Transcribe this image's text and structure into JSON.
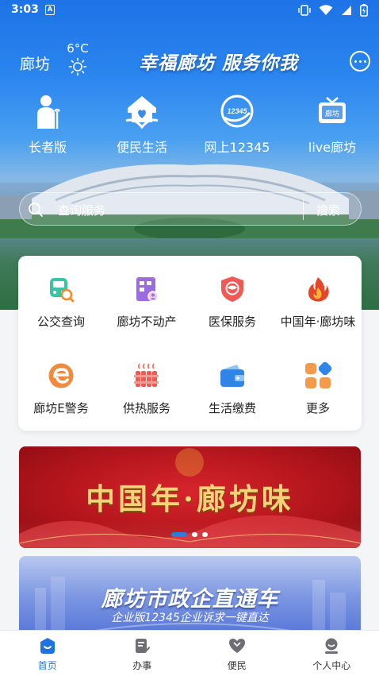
{
  "status_bar": {
    "time": "3:03",
    "notif_letter": "A"
  },
  "header": {
    "city": "廊坊",
    "temperature": "6°C",
    "weather_icon": "sun-icon",
    "slogan": "幸福廊坊 服务你我"
  },
  "quick_entries": [
    {
      "label": "长者版",
      "icon": "elder-icon"
    },
    {
      "label": "便民生活",
      "icon": "home-heart-icon"
    },
    {
      "label": "网上12345",
      "icon": "hotline-12345-icon",
      "badge": "12345"
    },
    {
      "label": "live廊坊",
      "icon": "tv-icon",
      "badge": "廊坊"
    }
  ],
  "search": {
    "placeholder": "查询服务",
    "button": "搜索"
  },
  "services": [
    {
      "label": "公交查询",
      "icon": "bus-search-icon"
    },
    {
      "label": "廊坊不动产",
      "icon": "property-icon"
    },
    {
      "label": "医保服务",
      "icon": "medical-insurance-icon"
    },
    {
      "label": "中国年·廊坊味",
      "icon": "flame-icon"
    },
    {
      "label": "廊坊E警务",
      "icon": "police-e-icon"
    },
    {
      "label": "供热服务",
      "icon": "heater-icon"
    },
    {
      "label": "生活缴费",
      "icon": "wallet-icon"
    },
    {
      "label": "更多",
      "icon": "more-grid-icon"
    }
  ],
  "banners": [
    {
      "title": "中国年·廊坊味"
    },
    {
      "title": "廊坊市政企直通车",
      "subtitle": "企业版12345企业诉求一键直达"
    }
  ],
  "carousel": {
    "count": 3,
    "active_index": 0
  },
  "tabbar": [
    {
      "label": "首页",
      "icon": "home-icon",
      "active": true
    },
    {
      "label": "办事",
      "icon": "task-icon",
      "active": false
    },
    {
      "label": "便民",
      "icon": "heart-icon",
      "active": false
    },
    {
      "label": "个人中心",
      "icon": "user-icon",
      "active": false
    }
  ],
  "colors": {
    "primary": "#1f73e0",
    "banner_red": "#c8161f",
    "banner_gold": "#f6d27a"
  }
}
